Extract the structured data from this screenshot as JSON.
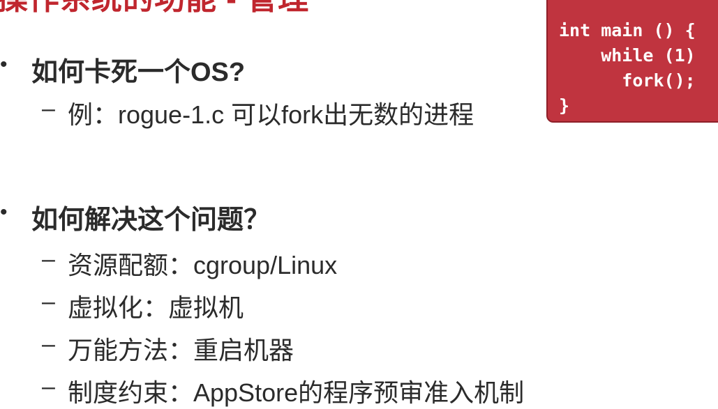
{
  "title": "操作系统的功能 - 管理",
  "code": {
    "lines": [
      "int main () {",
      "    while (1)",
      "      fork();",
      "}"
    ]
  },
  "bullets": [
    {
      "bullet_glyph": "•",
      "text": "如何卡死一个OS?",
      "subs": [
        {
          "dash": "–",
          "text": "例：rogue-1.c 可以fork出无数的进程"
        }
      ]
    },
    {
      "bullet_glyph": "•",
      "text": "如何解决这个问题？",
      "subs": [
        {
          "dash": "–",
          "text": "资源配额：cgroup/Linux"
        },
        {
          "dash": "–",
          "text": "虚拟化：虚拟机"
        },
        {
          "dash": "–",
          "text": "万能方法：重启机器"
        },
        {
          "dash": "–",
          "text": "制度约束：AppStore的程序预审准入机制"
        }
      ]
    }
  ]
}
